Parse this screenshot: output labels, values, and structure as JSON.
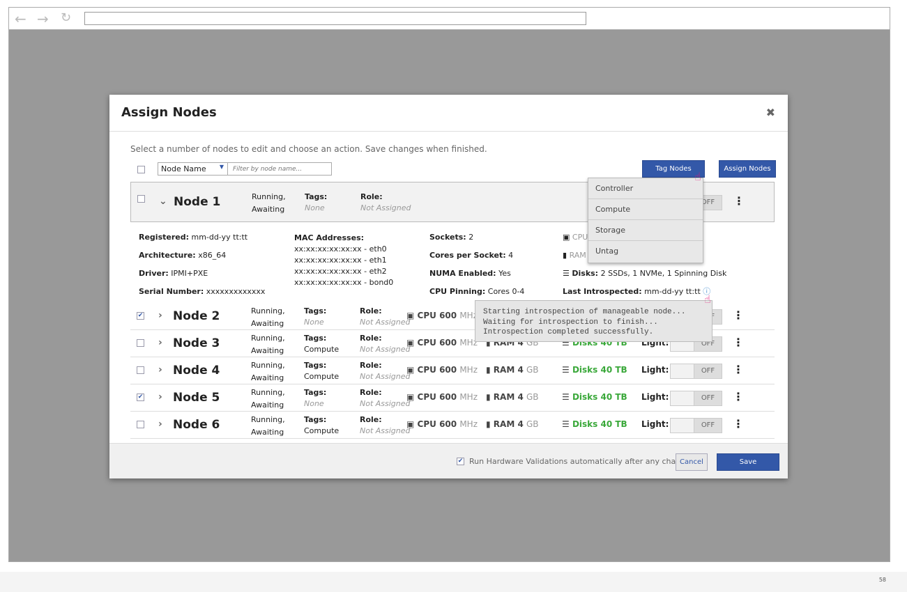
{
  "modal": {
    "title": "Assign Nodes",
    "instructions": "Select a number of nodes to edit and choose an action. Save changes when finished.",
    "filter_select": "Node Name",
    "filter_placeholder": "Filter by node name...",
    "tag_nodes": "Tag Nodes",
    "assign_nodes": "Assign Nodes",
    "run_validations": "Run Hardware Validations automatically after any changes",
    "cancel": "Cancel",
    "save": "Save"
  },
  "labels": {
    "tags": "Tags:",
    "role": "Role:",
    "light": "Light:",
    "off": "OFF",
    "status1": "Running,",
    "status2": "Awaiting",
    "cpu": "CPU",
    "ram": "RAM",
    "disks": "Disks",
    "kebab": "⋮"
  },
  "nodes": [
    {
      "name": "Node 1",
      "checked": false,
      "expanded": true,
      "tags": "None",
      "role": "Not Assigned"
    },
    {
      "name": "Node 2",
      "checked": true,
      "tags": "None",
      "role": "Not Assigned",
      "cpu": "600",
      "cpu_unit": "MHz",
      "ram": "4",
      "ram_unit": "GB",
      "disks": "40 TB"
    },
    {
      "name": "Node 3",
      "checked": false,
      "tags": "Compute",
      "role": "Not Assigned",
      "cpu": "600",
      "cpu_unit": "MHz",
      "ram": "4",
      "ram_unit": "GB",
      "disks": "40 TB"
    },
    {
      "name": "Node 4",
      "checked": false,
      "tags": "Compute",
      "role": "Not Assigned",
      "cpu": "600",
      "cpu_unit": "MHz",
      "ram": "4",
      "ram_unit": "GB",
      "disks": "40 TB"
    },
    {
      "name": "Node 5",
      "checked": true,
      "tags": "None",
      "role": "Not Assigned",
      "cpu": "600",
      "cpu_unit": "MHz",
      "ram": "4",
      "ram_unit": "GB",
      "disks": "40 TB"
    },
    {
      "name": "Node 6",
      "checked": false,
      "tags": "Compute",
      "role": "Not Assigned",
      "cpu": "600",
      "cpu_unit": "MHz",
      "ram": "4",
      "ram_unit": "GB",
      "disks": "40 TB"
    }
  ],
  "details": {
    "registered_l": "Registered:",
    "registered": "mm-dd-yy tt:tt",
    "arch_l": "Architecture:",
    "arch": "x86_64",
    "driver_l": "Driver:",
    "driver": "IPMI+PXE",
    "serial_l": "Serial Number:",
    "serial": "xxxxxxxxxxxxx",
    "mac_l": "MAC Addresses:",
    "macs": [
      "xx:xx:xx:xx:xx:xx - eth0",
      "xx:xx:xx:xx:xx:xx - eth1",
      "xx:xx:xx:xx:xx:xx - eth2",
      "xx:xx:xx:xx:xx:xx - bond0"
    ],
    "sockets_l": "Sockets:",
    "sockets": "2",
    "cores_l": "Cores per Socket:",
    "cores": "4",
    "numa_l": "NUMA Enabled:",
    "numa": "Yes",
    "pin_l": "CPU Pinning:",
    "pin": "Cores 0-4",
    "cpu_avail": "CPU 600 MHz Available",
    "ram_avail": "RAM 4 GB Available",
    "disks_l": "Disks:",
    "disks": "2 SSDs, 1 NVMe, 1 Spinning Disk",
    "intro_l": "Last Introspected:",
    "intro": "mm-dd-yy tt:tt"
  },
  "dropdown": [
    "Controller",
    "Compute",
    "Storage",
    "Untag"
  ],
  "tooltip": "Starting introspection of manageable node...\nWaiting for introspection to finish...\nIntrospection completed successfully.",
  "page_number": "58"
}
